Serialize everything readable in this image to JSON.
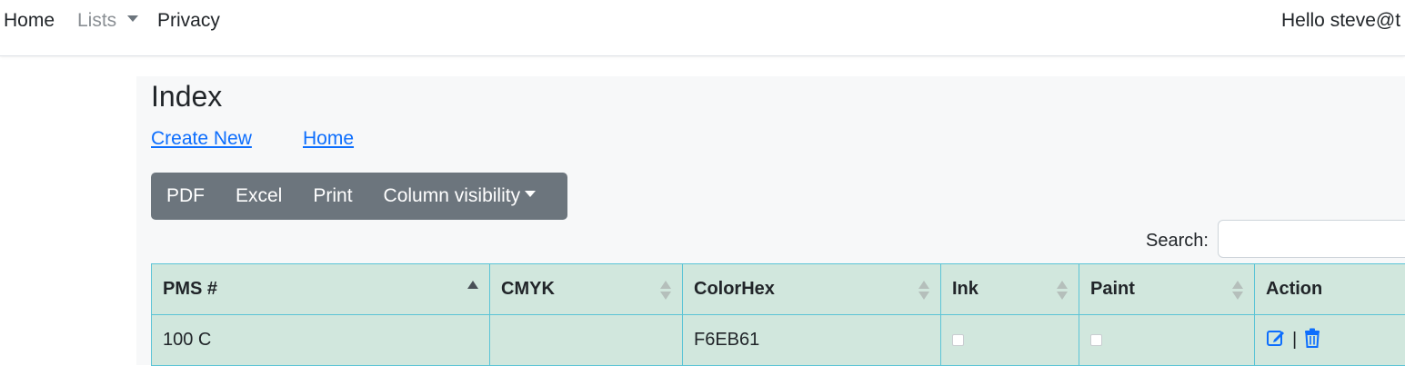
{
  "nav": {
    "home": "Home",
    "lists": "Lists",
    "privacy": "Privacy",
    "user": "Hello steve@t"
  },
  "page": {
    "title": "Index",
    "create_new": "Create New",
    "home_link": "Home"
  },
  "toolbar": {
    "pdf": "PDF",
    "excel": "Excel",
    "print": "Print",
    "column_visibility": "Column visibility"
  },
  "search": {
    "label": "Search:",
    "value": ""
  },
  "table": {
    "headers": [
      "PMS #",
      "CMYK",
      "ColorHex",
      "Ink",
      "Paint",
      "Action"
    ],
    "sort": {
      "column": "PMS #",
      "direction": "ascending"
    },
    "rows": [
      {
        "pms": "100 C",
        "cmyk": "",
        "colorhex": "F6EB61",
        "ink": false,
        "paint": false,
        "action_separator": "|"
      }
    ]
  },
  "colors": {
    "table_bg": "#d1e7dd",
    "table_border": "#5bc4d6",
    "button_group": "#6c757d",
    "link": "#0d6efd",
    "content_bg": "#f7f8f9"
  },
  "icons": {
    "edit": "pencil-square-icon",
    "delete": "trash-icon",
    "sort_asc": "sort-ascending-icon",
    "sort_both": "sort-both-icon"
  }
}
